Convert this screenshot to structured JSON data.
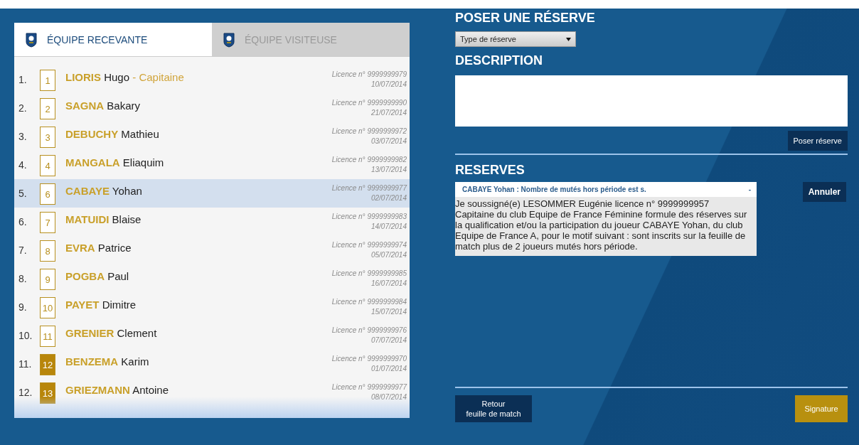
{
  "tabs": [
    {
      "label": "ÉQUIPE RECEVANTE",
      "selected": true
    },
    {
      "label": "ÉQUIPE VISITEUSE",
      "selected": false
    }
  ],
  "players": [
    {
      "order": "1.",
      "number": "1",
      "substitute": false,
      "surname": "LIORIS",
      "firstname": "Hugo",
      "role": "- Capitaine",
      "licence": "Licence n° 9999999979",
      "date": "10/07/2014",
      "selected": false
    },
    {
      "order": "2.",
      "number": "2",
      "substitute": false,
      "surname": "SAGNA",
      "firstname": "Bakary",
      "licence": "Licence n° 9999999990",
      "date": "21/07/2014",
      "selected": false
    },
    {
      "order": "3.",
      "number": "3",
      "substitute": false,
      "surname": "DEBUCHY",
      "firstname": "Mathieu",
      "licence": "Licence n° 9999999972",
      "date": "03/07/2014",
      "selected": false
    },
    {
      "order": "4.",
      "number": "4",
      "substitute": false,
      "surname": "MANGALA",
      "firstname": "Eliaquim",
      "licence": "Licence n° 9999999982",
      "date": "13/07/2014",
      "selected": false
    },
    {
      "order": "5.",
      "number": "6",
      "substitute": false,
      "surname": "CABAYE",
      "firstname": "Yohan",
      "licence": "Licence n° 9999999977",
      "date": "02/07/2014",
      "selected": true
    },
    {
      "order": "6.",
      "number": "7",
      "substitute": false,
      "surname": "MATUIDI",
      "firstname": "Blaise",
      "licence": "Licence n° 9999999983",
      "date": "14/07/2014",
      "selected": false
    },
    {
      "order": "7.",
      "number": "8",
      "substitute": false,
      "surname": "EVRA",
      "firstname": "Patrice",
      "licence": "Licence n° 9999999974",
      "date": "05/07/2014",
      "selected": false
    },
    {
      "order": "8.",
      "number": "9",
      "substitute": false,
      "surname": "POGBA",
      "firstname": "Paul",
      "licence": "Licence n° 9999999985",
      "date": "16/07/2014",
      "selected": false
    },
    {
      "order": "9.",
      "number": "10",
      "substitute": false,
      "surname": "PAYET",
      "firstname": "Dimitre",
      "licence": "Licence n° 9999999984",
      "date": "15/07/2014",
      "selected": false
    },
    {
      "order": "10.",
      "number": "11",
      "substitute": false,
      "surname": "GRENIER",
      "firstname": "Clement",
      "licence": "Licence n° 9999999976",
      "date": "07/07/2014",
      "selected": false
    },
    {
      "order": "11.",
      "number": "12",
      "substitute": true,
      "surname": "BENZEMA",
      "firstname": "Karim",
      "licence": "Licence n° 9999999970",
      "date": "01/07/2014",
      "selected": false
    },
    {
      "order": "12.",
      "number": "13",
      "substitute": true,
      "surname": "GRIEZMANN",
      "firstname": "Antoine",
      "licence": "Licence n° 9999999977",
      "date": "08/07/2014",
      "selected": false
    }
  ],
  "reserve_form": {
    "title": "POSER UNE RÉSERVE",
    "type_select": "Type de réserve",
    "description_title": "DESCRIPTION",
    "submit_button": "Poser réserve"
  },
  "reserves": {
    "title": "RESERVES",
    "items": [
      {
        "header": "CABAYE Yohan : Nombre de mutés hors période est s.",
        "toggle": "-",
        "expanded": true,
        "text": "Je soussigné(e) LESOMMER Eugénie licence n° 9999999957 Capitaine du club Equipe de France Féminine formule des réserves sur la qualification et/ou la participation du joueur CABAYE Yohan, du club Equipe de France A, pour le motif suivant : sont inscrits sur la feuille de match plus de 2 joueurs mutés hors période.",
        "cancel_button": "Annuler"
      }
    ]
  },
  "footer": {
    "back_button": "Retour\nfeuille de match",
    "signature_button": "Signature"
  }
}
